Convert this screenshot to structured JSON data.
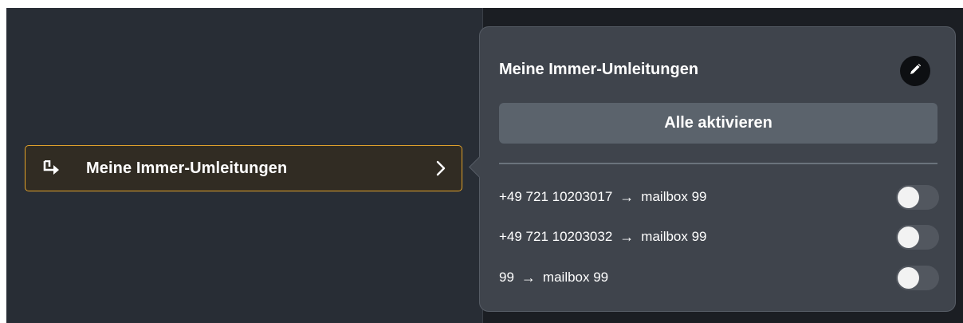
{
  "nav": {
    "item_label": "Meine Immer-Umleitungen",
    "icon": "call-forward-icon",
    "chevron": "chevron-right-icon"
  },
  "popover": {
    "title": "Meine Immer-Umleitungen",
    "edit_icon": "pencil-icon",
    "activate_all_label": "Alle aktivieren",
    "rules": [
      {
        "from": "+49 721 10203017",
        "arrow": "→",
        "to": "mailbox 99",
        "enabled": false
      },
      {
        "from": "+49 721 10203032",
        "arrow": "→",
        "to": "mailbox 99",
        "enabled": false
      },
      {
        "from": "99",
        "arrow": "→",
        "to": "mailbox 99",
        "enabled": false
      }
    ]
  },
  "colors": {
    "accent": "#e0a12b",
    "left_bg": "#282d35",
    "right_bg": "#1b1e23",
    "popover_bg": "#3f444c",
    "button_bg": "#5b636c",
    "toggle_off": "#52575f"
  }
}
